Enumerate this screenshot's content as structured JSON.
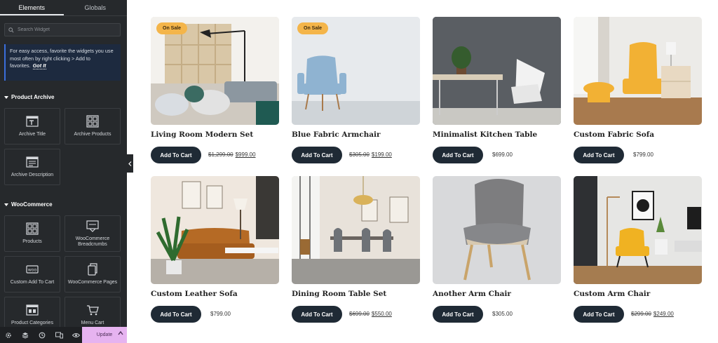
{
  "sidebar": {
    "tabs": [
      {
        "label": "Elements",
        "active": true
      },
      {
        "label": "Globals",
        "active": false
      }
    ],
    "search": {
      "placeholder": "Search Widget"
    },
    "tip": {
      "text": "For easy access, favorite the widgets you use most often by right clicking > Add to favorites.",
      "action": "Got It"
    },
    "sections": [
      {
        "title": "Product Archive",
        "widgets": [
          "Archive Title",
          "Archive Products",
          "Archive Description"
        ]
      },
      {
        "title": "WooCommerce",
        "widgets": [
          "Products",
          "WooCommerce Breadcrumbs",
          "Custom Add To Cart",
          "WooCommerce Pages",
          "Product Categories",
          "Menu Cart"
        ]
      }
    ],
    "bottom": {
      "update_label": "Update",
      "icons": [
        "settings-icon",
        "layers-icon",
        "history-icon",
        "responsive-icon",
        "preview-icon"
      ]
    }
  },
  "products": [
    {
      "name": "Living Room Modern Set",
      "badge": "On Sale",
      "regular_price": "$1,299.00",
      "sale_price": "$999.00",
      "button": "Add To Cart"
    },
    {
      "name": "Blue Fabric Armchair",
      "badge": "On Sale",
      "regular_price": "$305.00",
      "sale_price": "$199.00",
      "button": "Add To Cart"
    },
    {
      "name": "Minimalist Kitchen Table",
      "badge": "",
      "regular_price": "",
      "sale_price": "$699.00",
      "button": "Add To Cart"
    },
    {
      "name": "Custom Fabric Sofa",
      "badge": "",
      "regular_price": "",
      "sale_price": "$799.00",
      "button": "Add To Cart"
    },
    {
      "name": "Custom Leather Sofa",
      "badge": "",
      "regular_price": "",
      "sale_price": "$799.00",
      "button": "Add To Cart"
    },
    {
      "name": "Dining Room Table Set",
      "badge": "",
      "regular_price": "$699.00",
      "sale_price": "$550.00",
      "button": "Add To Cart"
    },
    {
      "name": "Another Arm Chair",
      "badge": "",
      "regular_price": "",
      "sale_price": "$305.00",
      "button": "Add To Cart"
    },
    {
      "name": "Custom Arm Chair",
      "badge": "",
      "regular_price": "$299.00",
      "sale_price": "$249.00",
      "button": "Add To Cart"
    }
  ],
  "colors": {
    "sidebar_bg": "#26292c",
    "tip_bg": "#1d2a3f",
    "button_bg": "#1f2a35",
    "badge_bg": "#f4b54a",
    "update_bg": "#e6b3f0"
  }
}
